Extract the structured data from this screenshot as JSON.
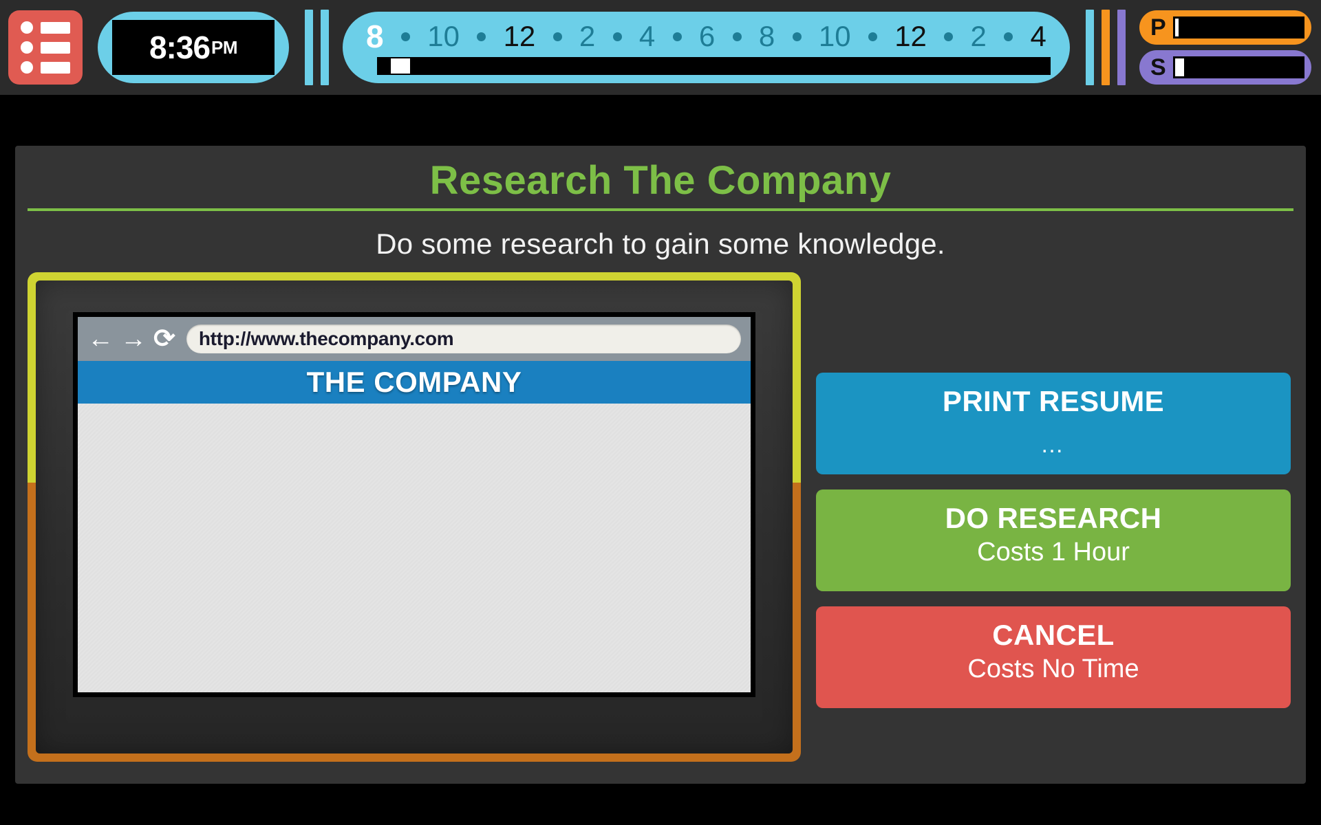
{
  "topbar": {
    "menu_icon": "list-menu-icon",
    "clock": {
      "time": "8:36",
      "meridiem": "PM"
    },
    "timeline": {
      "hours": [
        {
          "label": "8",
          "style": "white"
        },
        {
          "label": "10",
          "style": "teal"
        },
        {
          "label": "12",
          "style": "black"
        },
        {
          "label": "2",
          "style": "teal"
        },
        {
          "label": "4",
          "style": "teal"
        },
        {
          "label": "6",
          "style": "teal"
        },
        {
          "label": "8",
          "style": "teal"
        },
        {
          "label": "10",
          "style": "teal"
        },
        {
          "label": "12",
          "style": "black"
        },
        {
          "label": "2",
          "style": "teal"
        },
        {
          "label": "4",
          "style": "black"
        }
      ],
      "progress_percent": 2
    },
    "stats": [
      {
        "letter": "P",
        "name": "performance-stat",
        "color": "#f7941e",
        "fill_percent": 3
      },
      {
        "letter": "S",
        "name": "stress-stat",
        "color": "#8878d0",
        "fill_percent": 7
      }
    ],
    "dividers": [
      "#6ccfe8",
      "#6ccfe8"
    ],
    "stat_dividers": [
      "#6ccfe8",
      "#f7941e",
      "#8878d0"
    ]
  },
  "panel": {
    "title": "Research The Company",
    "subtitle": "Do some research to gain some knowledge.",
    "accent_color": "#7dbf47"
  },
  "monitor": {
    "browser": {
      "back_icon": "←",
      "forward_icon": "→",
      "reload_icon": "⟳",
      "url": "http://www.thecompany.com"
    },
    "site": {
      "banner_title": "THE COMPANY"
    },
    "frame_top_color": "#cfd432",
    "frame_bottom_color": "#c4701c"
  },
  "actions": [
    {
      "name": "print-resume-button",
      "label": "PRINT RESUME",
      "cost": "…",
      "color": "#1b94c2",
      "variant": "blue"
    },
    {
      "name": "do-research-button",
      "label": "DO RESEARCH",
      "cost": "Costs 1 Hour",
      "color": "#79b443",
      "variant": "green"
    },
    {
      "name": "cancel-button",
      "label": "CANCEL",
      "cost": "Costs No Time",
      "color": "#e0554f",
      "variant": "red"
    }
  ]
}
